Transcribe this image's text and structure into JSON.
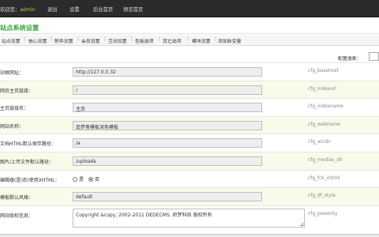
{
  "header": {
    "greeting": "欢迎您：",
    "username": "admin",
    "nav": [
      "退出",
      "设置",
      "后台首页",
      "预览首页"
    ]
  },
  "page_title": "站点系统设置",
  "tabs": [
    "站点设置",
    "核心设置",
    "附件设置",
    "会员设置",
    "互动设置",
    "性能选项",
    "其它选项",
    "模块设置",
    "添加新变量"
  ],
  "search": {
    "label": "配置搜索：",
    "value": ""
  },
  "rows": [
    {
      "label": "站根网址：",
      "value": "http://127.0.0.32",
      "key": "cfg_basehost"
    },
    {
      "label": "网页主页链接：",
      "value": "/",
      "key": "cfg_indexurl"
    },
    {
      "label": "主页链接名：",
      "value": "主页",
      "key": "cfg_indexname"
    },
    {
      "label": "网站名称：",
      "value": "追梦者模板深色模板",
      "key": "cfg_webname"
    },
    {
      "label": "文档HTML默认保存路径：",
      "value": "/a",
      "key": "cfg_arcdir"
    },
    {
      "label": "图片/上传文件默认路径：",
      "value": "/uploads",
      "key": "cfg_medias_dir"
    },
    {
      "label": "编辑器(是/否)使用XHTML：",
      "radio_yes": "是",
      "radio_no": "否",
      "selected": "否",
      "key": "cfg_fck_xhtml"
    },
    {
      "label": "模板默认风格：",
      "value": "default",
      "key": "cfg_df_style"
    },
    {
      "label": "网站版权信息：",
      "value": "Copyright &copy; 2002-2011 DEDECMS. 织梦科技 版权所有",
      "key": "cfg_powerby"
    }
  ]
}
